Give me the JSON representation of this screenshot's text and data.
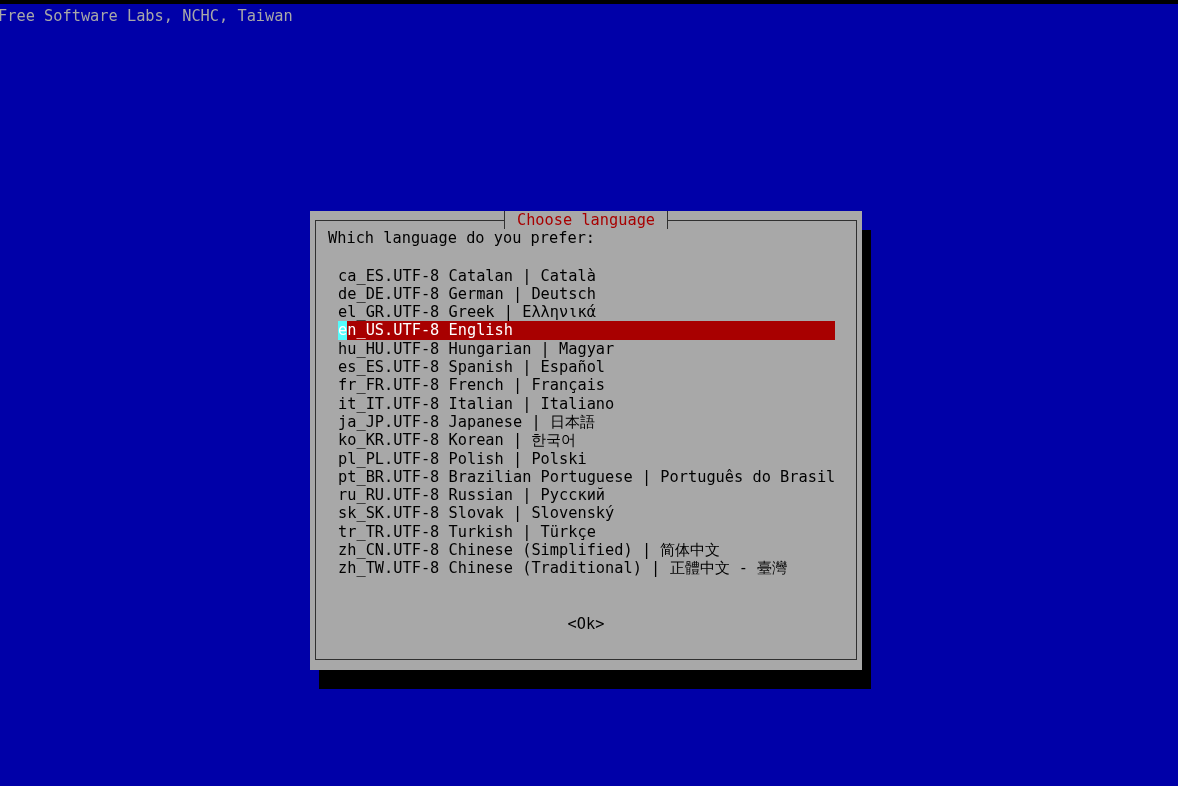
{
  "header": "Free Software Labs, NCHC, Taiwan",
  "dialog": {
    "title": "Choose language",
    "prompt": "Which language do you prefer:",
    "items": [
      {
        "label": "ca_ES.UTF-8 Catalan | Català",
        "selected": false
      },
      {
        "label": "de_DE.UTF-8 German | Deutsch",
        "selected": false
      },
      {
        "label": "el_GR.UTF-8 Greek | Ελληνικά",
        "selected": false
      },
      {
        "label": "en_US.UTF-8 English",
        "selected": true
      },
      {
        "label": "hu_HU.UTF-8 Hungarian | Magyar",
        "selected": false
      },
      {
        "label": "es_ES.UTF-8 Spanish | Español",
        "selected": false
      },
      {
        "label": "fr_FR.UTF-8 French | Français",
        "selected": false
      },
      {
        "label": "it_IT.UTF-8 Italian | Italiano",
        "selected": false
      },
      {
        "label": "ja_JP.UTF-8 Japanese | 日本語",
        "selected": false
      },
      {
        "label": "ko_KR.UTF-8 Korean | 한국어",
        "selected": false
      },
      {
        "label": "pl_PL.UTF-8 Polish | Polski",
        "selected": false
      },
      {
        "label": "pt_BR.UTF-8 Brazilian Portuguese | Português do Brasil",
        "selected": false
      },
      {
        "label": "ru_RU.UTF-8 Russian | Русский",
        "selected": false
      },
      {
        "label": "sk_SK.UTF-8 Slovak | Slovenský",
        "selected": false
      },
      {
        "label": "tr_TR.UTF-8 Turkish | Türkçe",
        "selected": false
      },
      {
        "label": "zh_CN.UTF-8 Chinese (Simplified) | 简体中文",
        "selected": false
      },
      {
        "label": "zh_TW.UTF-8 Chinese (Traditional) | 正體中文 - 臺灣",
        "selected": false
      }
    ],
    "button": "<Ok>"
  }
}
